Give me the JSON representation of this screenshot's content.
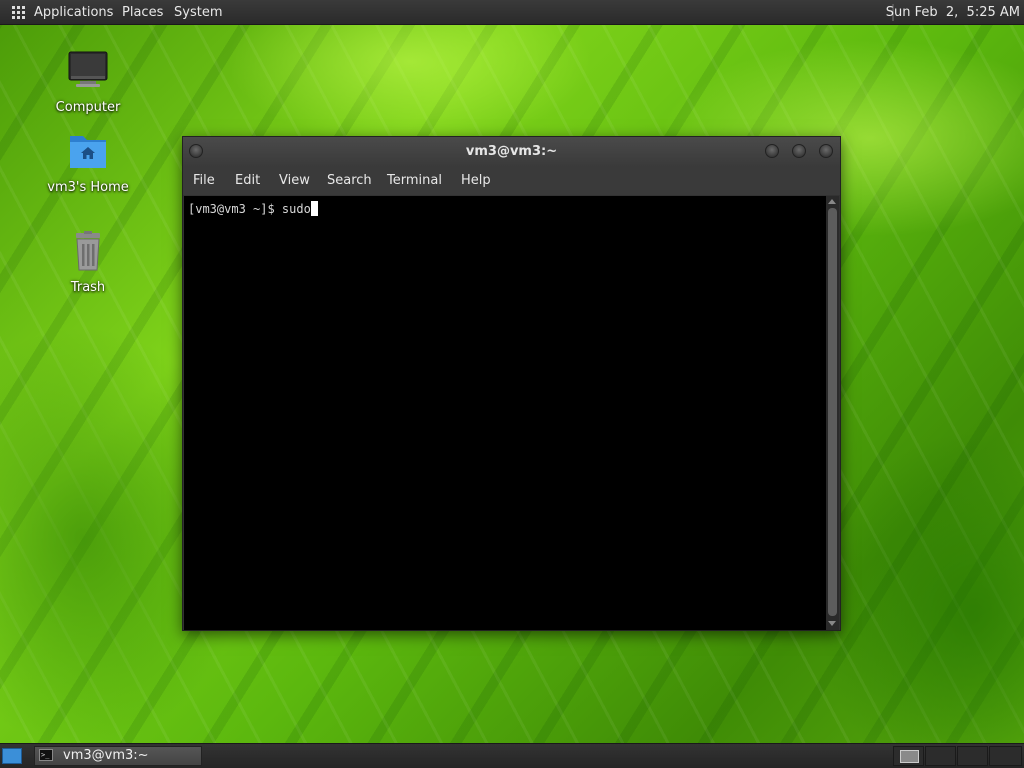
{
  "top_panel": {
    "menus": [
      "Applications",
      "Places",
      "System"
    ],
    "clock": "Sun Feb  2,  5:25 AM"
  },
  "desktop": {
    "icons": [
      {
        "label": "Computer",
        "icon": "computer-icon"
      },
      {
        "label": "vm3's Home",
        "icon": "home-folder-icon"
      },
      {
        "label": "Trash",
        "icon": "trash-icon"
      }
    ]
  },
  "terminal_window": {
    "title": "vm3@vm3:~",
    "menu": [
      "File",
      "Edit",
      "View",
      "Search",
      "Terminal",
      "Help"
    ],
    "prompt": "[vm3@vm3 ~]$ ",
    "typed": "sudo"
  },
  "bottom_panel": {
    "tasks": [
      {
        "label": "vm3@vm3:~",
        "icon": "terminal-icon"
      }
    ],
    "workspaces": 4,
    "active_workspace": 1
  },
  "colors": {
    "panel": "#2e2e2e",
    "terminal_bg": "#000000",
    "accent_blue": "#3b8fd8",
    "wallpaper_green": "#6cc814"
  }
}
